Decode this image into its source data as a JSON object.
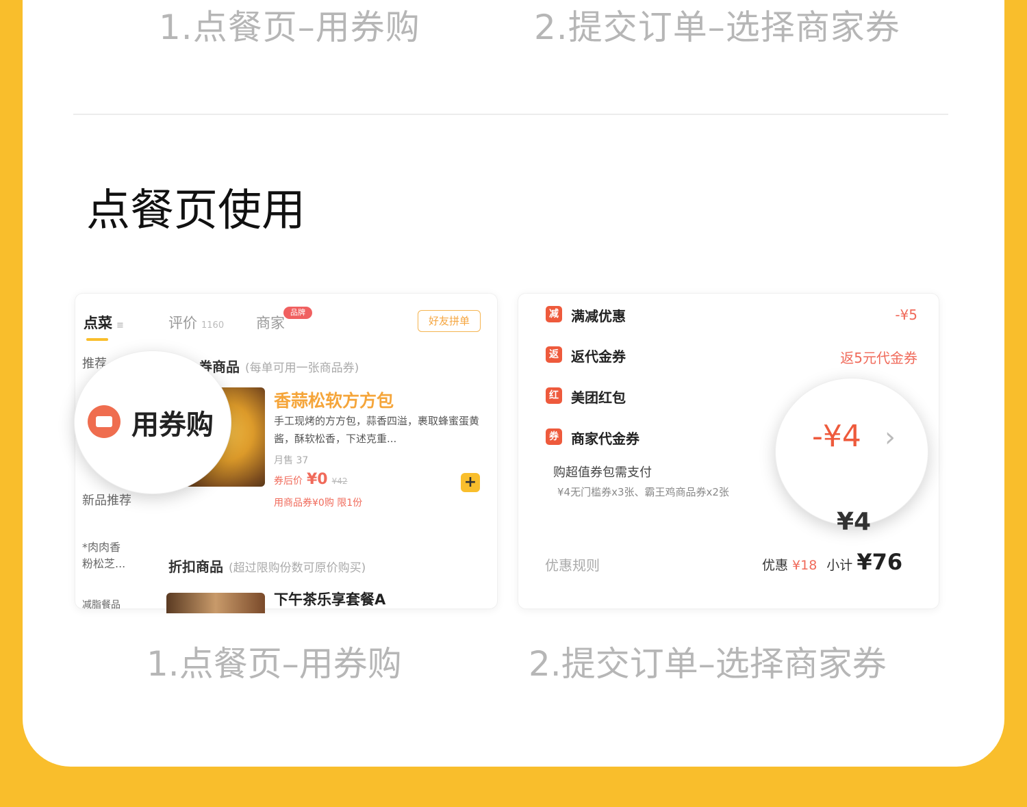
{
  "top_captions": [
    "1.点餐页–用券购",
    "2.提交订单–选择商家券"
  ],
  "section_title": "点餐页使用",
  "left_shot": {
    "tabs": [
      {
        "label": "点菜",
        "count": "≡"
      },
      {
        "label": "评价",
        "count": "1160"
      },
      {
        "label": "商家",
        "count": ""
      }
    ],
    "merchant_badge": "品牌",
    "group_button": "好友拼单",
    "sidebar": [
      "推荐",
      "新品推荐",
      "*肉肉香\n粉松芝...",
      "减脂餐品"
    ],
    "coupon_section": {
      "title": "券商品",
      "note": "(每单可用一张商品券)"
    },
    "magnifier_label": "用券购",
    "item": {
      "title": "香蒜松软方方包",
      "desc": "手工现烤的方方包，蒜香四溢，裹取蜂蜜蛋黄酱，酥软松香，下述克重...",
      "sales": "月售 37",
      "price_label": "券后价",
      "price": "¥0",
      "original": "¥42",
      "limit": "用商品券¥0购 限1份",
      "add": "+"
    },
    "discount_section": {
      "title": "折扣商品",
      "note": "(超过限购份数可原价购买)"
    },
    "item2_title": "下午茶乐享套餐A"
  },
  "right_shot": {
    "rows": [
      {
        "icon": "减",
        "label": "满减优惠",
        "value": "-¥5"
      },
      {
        "icon": "返",
        "label": "返代金券",
        "value": "返5元代金券"
      },
      {
        "icon": "红",
        "label": "美团红包",
        "value": ""
      },
      {
        "icon": "券",
        "label": "商家代金券",
        "value": ""
      }
    ],
    "package_title": "购超值券包需支付",
    "package_desc": "¥4无门槛券x3张、霸王鸡商品券x2张",
    "magnifier_value": "-¥4",
    "magnifier_bottom": "¥4",
    "rule_label": "优惠规则",
    "discount_label": "优惠",
    "discount_value": "¥18",
    "subtotal_label": "小计",
    "subtotal_value": "¥76"
  },
  "captions": [
    "1.点餐页–用券购",
    "2.提交订单–选择商家券"
  ]
}
